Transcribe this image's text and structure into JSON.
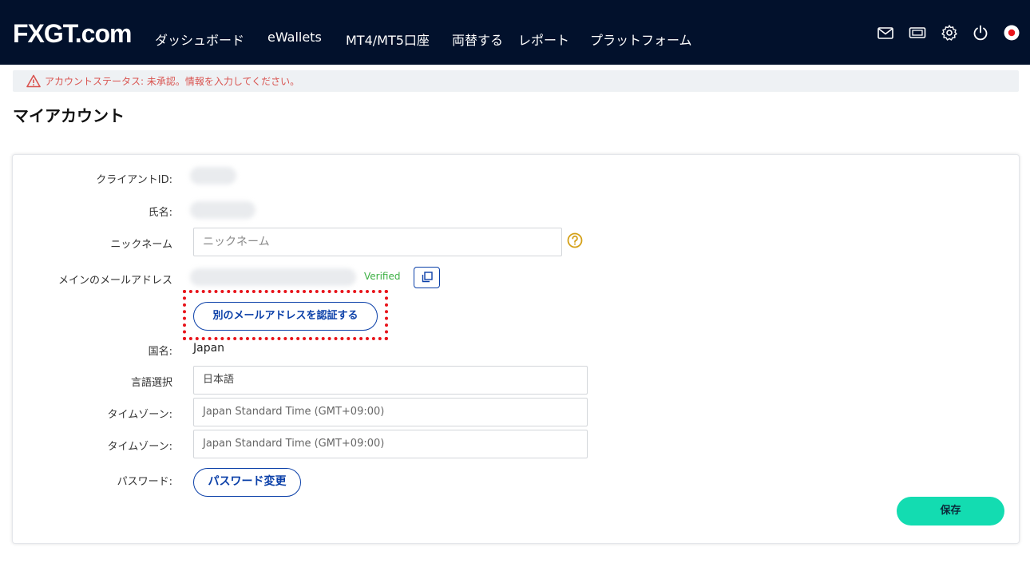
{
  "header": {
    "logo": "FXGT.com",
    "nav": [
      "ダッシュボード",
      "eWallets",
      "MT4/MT5口座",
      "両替する",
      "レポート",
      "プラットフォーム"
    ],
    "icons": [
      "mail-icon",
      "ticket-icon",
      "gear-icon",
      "power-icon",
      "flag-japan-icon"
    ]
  },
  "alert": {
    "text": "アカウントステータス: 未承認。情報を入力してください。",
    "color": "#d9534f"
  },
  "page": {
    "title": "マイアカウント"
  },
  "form": {
    "client_id_label": "クライアントID:",
    "name_label": "氏名:",
    "nickname_label": "ニックネーム",
    "nickname_placeholder": "ニックネーム",
    "nickname_value": "",
    "email_label": "メインのメールアドレス",
    "email_status": "Verified",
    "verify_other_email_button": "別のメールアドレスを認証する",
    "country_label": "国名:",
    "country_value": "Japan",
    "language_label": "言語選択",
    "language_value": "日本語",
    "timezone_label_1": "タイムゾーン:",
    "timezone_value_1": "Japan Standard Time (GMT+09:00)",
    "timezone_label_2": "タイムゾーン:",
    "timezone_value_2": "Japan Standard Time (GMT+09:00)",
    "password_label": "パスワード:",
    "change_password_button": "パスワード変更",
    "save_button": "保存"
  },
  "colors": {
    "header_bg": "#02112c",
    "accent_blue": "#0a3fa8",
    "save_green": "#13dcb1",
    "verified_green": "#3cb043",
    "highlight_red": "#e8141b"
  }
}
